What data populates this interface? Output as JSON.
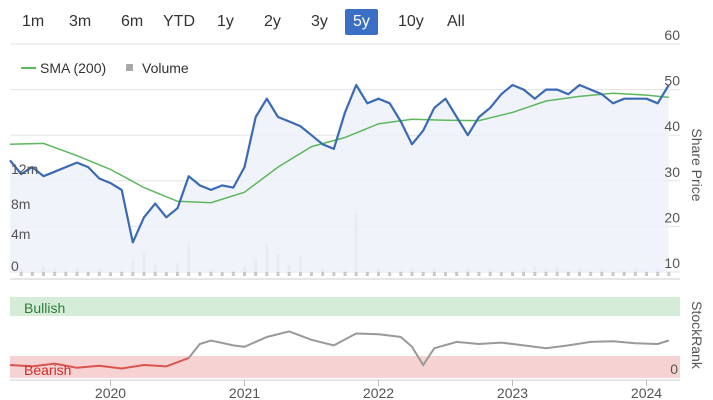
{
  "range_tabs": {
    "items": [
      "1m",
      "3m",
      "6m",
      "YTD",
      "1y",
      "2y",
      "3y",
      "5y",
      "10y",
      "All"
    ],
    "active": "5y"
  },
  "legend": {
    "sma_label": "SMA (200)",
    "volume_label": "Volume"
  },
  "colors": {
    "price": "#3a6ab5",
    "price_fill": "#eef1f9",
    "sma": "#5cb85c",
    "volume": "#c8c8c8",
    "bullish_band": "#d5ecd8",
    "bearish_band": "#f7d2d2",
    "stockrank_bullish": "#999999",
    "stockrank_bearish": "#d9534f",
    "active_tab": "#3b6fc4"
  },
  "chart_data": [
    {
      "type": "line",
      "title": "",
      "ylabel": "Share Price",
      "ylim": [
        10,
        60
      ],
      "yticks": [
        10,
        20,
        30,
        40,
        50,
        60
      ],
      "xticks": [
        "2020",
        "2021",
        "2022",
        "2023",
        "2024"
      ],
      "xlim": [
        "2019-04",
        "2024-04"
      ],
      "grid": true,
      "legend_position": "top-left",
      "series": [
        {
          "name": "Share Price",
          "points": [
            [
              "2019-04",
              34.5
            ],
            [
              "2019-05",
              31.5
            ],
            [
              "2019-06",
              33
            ],
            [
              "2019-07",
              31
            ],
            [
              "2019-08",
              32
            ],
            [
              "2019-09",
              33
            ],
            [
              "2019-10",
              34
            ],
            [
              "2019-11",
              33
            ],
            [
              "2019-12",
              30.5
            ],
            [
              "2020-01",
              29.5
            ],
            [
              "2020-02",
              28
            ],
            [
              "2020-03",
              16.5
            ],
            [
              "2020-04",
              22
            ],
            [
              "2020-05",
              25
            ],
            [
              "2020-06",
              22
            ],
            [
              "2020-07",
              24
            ],
            [
              "2020-08",
              31
            ],
            [
              "2020-09",
              29
            ],
            [
              "2020-10",
              28
            ],
            [
              "2020-11",
              29
            ],
            [
              "2020-12",
              28.5
            ],
            [
              "2021-01",
              33
            ],
            [
              "2021-02",
              44
            ],
            [
              "2021-03",
              48
            ],
            [
              "2021-04",
              44
            ],
            [
              "2021-05",
              43
            ],
            [
              "2021-06",
              42
            ],
            [
              "2021-07",
              40
            ],
            [
              "2021-08",
              38
            ],
            [
              "2021-09",
              37
            ],
            [
              "2021-10",
              45
            ],
            [
              "2021-11",
              51
            ],
            [
              "2021-12",
              47
            ],
            [
              "2022-01",
              48
            ],
            [
              "2022-02",
              47
            ],
            [
              "2022-03",
              43
            ],
            [
              "2022-04",
              38
            ],
            [
              "2022-05",
              41
            ],
            [
              "2022-06",
              46
            ],
            [
              "2022-07",
              48
            ],
            [
              "2022-08",
              44
            ],
            [
              "2022-09",
              40
            ],
            [
              "2022-10",
              44
            ],
            [
              "2022-11",
              46
            ],
            [
              "2022-12",
              49
            ],
            [
              "2023-01",
              51
            ],
            [
              "2023-02",
              50
            ],
            [
              "2023-03",
              48
            ],
            [
              "2023-04",
              50
            ],
            [
              "2023-05",
              50
            ],
            [
              "2023-06",
              49
            ],
            [
              "2023-07",
              51
            ],
            [
              "2023-08",
              50
            ],
            [
              "2023-09",
              49
            ],
            [
              "2023-10",
              47
            ],
            [
              "2023-11",
              48
            ],
            [
              "2023-12",
              48
            ],
            [
              "2024-01",
              48
            ],
            [
              "2024-02",
              47
            ],
            [
              "2024-03",
              51
            ]
          ]
        },
        {
          "name": "SMA (200)",
          "points": [
            [
              "2019-04",
              38
            ],
            [
              "2019-07",
              38.2
            ],
            [
              "2019-10",
              35.5
            ],
            [
              "2020-01",
              32.5
            ],
            [
              "2020-04",
              28.5
            ],
            [
              "2020-07",
              25.5
            ],
            [
              "2020-10",
              25.2
            ],
            [
              "2021-01",
              27.5
            ],
            [
              "2021-04",
              33
            ],
            [
              "2021-07",
              37.5
            ],
            [
              "2021-10",
              39.5
            ],
            [
              "2022-01",
              42.5
            ],
            [
              "2022-04",
              43.5
            ],
            [
              "2022-07",
              43.3
            ],
            [
              "2022-10",
              43.2
            ],
            [
              "2023-01",
              45
            ],
            [
              "2023-04",
              47.5
            ],
            [
              "2023-07",
              48.5
            ],
            [
              "2023-10",
              49.2
            ],
            [
              "2024-01",
              48.8
            ],
            [
              "2024-03",
              48.3
            ]
          ]
        }
      ]
    },
    {
      "type": "bar",
      "title": "",
      "ylabel": "",
      "series_name": "Volume",
      "yticks": [
        "0",
        "4m",
        "8m",
        "12m"
      ],
      "ylim": [
        0,
        26
      ],
      "spikes": [
        [
          "2019-07",
          2.5
        ],
        [
          "2019-08",
          2
        ],
        [
          "2019-09",
          1.5
        ],
        [
          "2020-03",
          4
        ],
        [
          "2020-04",
          6.5
        ],
        [
          "2020-05",
          3
        ],
        [
          "2020-07",
          3.5
        ],
        [
          "2020-08",
          8.5
        ],
        [
          "2021-01",
          2.5
        ],
        [
          "2021-02",
          4.5
        ],
        [
          "2021-03",
          8.5
        ],
        [
          "2021-04",
          6
        ],
        [
          "2021-05",
          3
        ],
        [
          "2021-06",
          5.5
        ],
        [
          "2021-11",
          17
        ],
        [
          "2022-06",
          2
        ],
        [
          "2023-03",
          2.5
        ],
        [
          "2023-05",
          2.5
        ],
        [
          "2024-02",
          1.8
        ]
      ],
      "baseline": 1
    },
    {
      "type": "line",
      "title": "",
      "ylabel": "StockRank",
      "ylim": [
        0,
        100
      ],
      "yticks": [
        0
      ],
      "bands": [
        "Bullish",
        "Bearish"
      ],
      "points": [
        [
          "2019-04",
          10
        ],
        [
          "2019-06",
          8
        ],
        [
          "2019-08",
          12
        ],
        [
          "2019-10",
          6
        ],
        [
          "2019-12",
          9
        ],
        [
          "2020-02",
          5
        ],
        [
          "2020-04",
          10
        ],
        [
          "2020-06",
          8
        ],
        [
          "2020-08",
          20
        ],
        [
          "2020-09",
          40
        ],
        [
          "2020-10",
          45
        ],
        [
          "2020-12",
          38
        ],
        [
          "2021-01",
          36
        ],
        [
          "2021-03",
          50
        ],
        [
          "2021-05",
          58
        ],
        [
          "2021-07",
          46
        ],
        [
          "2021-09",
          38
        ],
        [
          "2021-11",
          55
        ],
        [
          "2022-01",
          54
        ],
        [
          "2022-03",
          50
        ],
        [
          "2022-04",
          36
        ],
        [
          "2022-05",
          10
        ],
        [
          "2022-06",
          34
        ],
        [
          "2022-08",
          43
        ],
        [
          "2022-10",
          40
        ],
        [
          "2022-12",
          42
        ],
        [
          "2023-02",
          38
        ],
        [
          "2023-04",
          34
        ],
        [
          "2023-06",
          38
        ],
        [
          "2023-08",
          43
        ],
        [
          "2023-10",
          44
        ],
        [
          "2023-12",
          41
        ],
        [
          "2024-02",
          40
        ],
        [
          "2024-03",
          45
        ]
      ]
    }
  ]
}
